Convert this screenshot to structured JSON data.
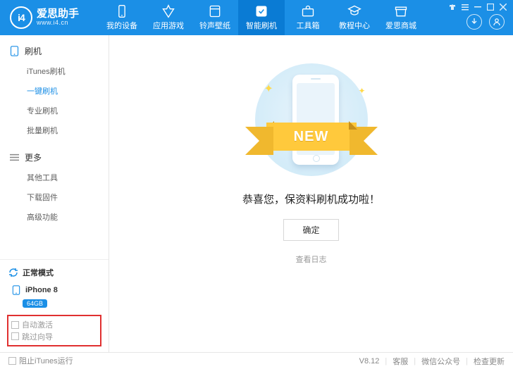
{
  "brand": {
    "name": "爱思助手",
    "url": "www.i4.cn",
    "logo": "i4"
  },
  "nav": [
    {
      "label": "我的设备"
    },
    {
      "label": "应用游戏"
    },
    {
      "label": "铃声壁纸"
    },
    {
      "label": "智能刷机"
    },
    {
      "label": "工具箱"
    },
    {
      "label": "教程中心"
    },
    {
      "label": "爱思商城"
    }
  ],
  "sidebar": {
    "section1": {
      "title": "刷机",
      "items": [
        "iTunes刷机",
        "一键刷机",
        "专业刷机",
        "批量刷机"
      ],
      "active_index": 1
    },
    "section2": {
      "title": "更多",
      "items": [
        "其他工具",
        "下载固件",
        "高级功能"
      ]
    },
    "mode": "正常模式",
    "device": {
      "name": "iPhone 8",
      "capacity": "64GB"
    },
    "opts": {
      "auto_activate": "自动激活",
      "skip_guide": "跳过向导"
    }
  },
  "main": {
    "ribbon": "NEW",
    "message": "恭喜您，保资料刷机成功啦！",
    "ok": "确定",
    "view_log": "查看日志"
  },
  "footer": {
    "block_itunes": "阻止iTunes运行",
    "version": "V8.12",
    "links": [
      "客服",
      "微信公众号",
      "检查更新"
    ]
  }
}
